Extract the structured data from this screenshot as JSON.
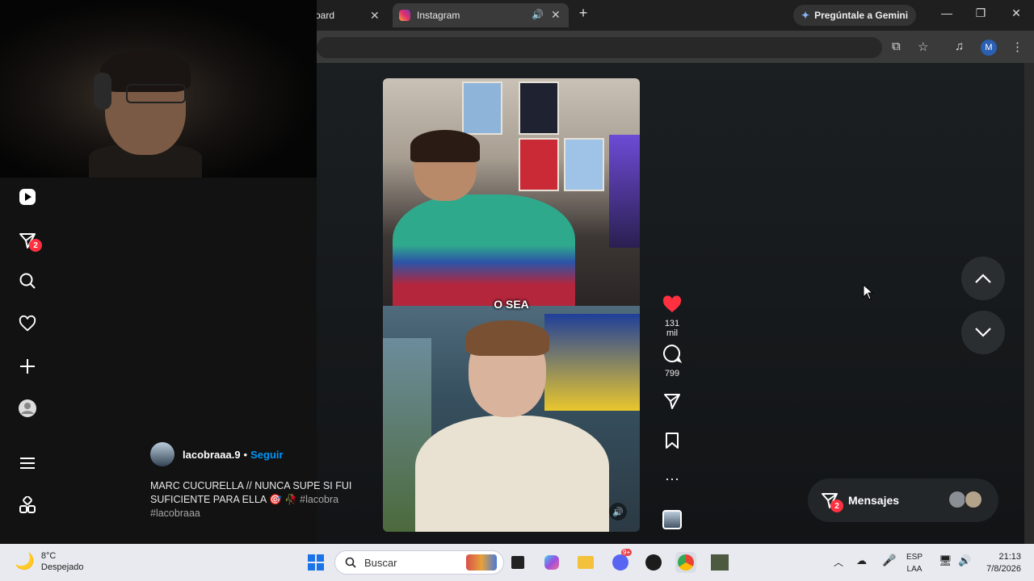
{
  "browser": {
    "tab_inactive_label": "oard",
    "tab_active_label": "Instagram",
    "gemini_label": "Pregúntale a Gemini",
    "profile_initial": "M"
  },
  "reel": {
    "overlay_caption": "O SEA",
    "likes": "131 mil",
    "comments": "799"
  },
  "post": {
    "username": "lacobraaa.9",
    "separator": "•",
    "follow_label": "Seguir",
    "description": "MARC CUCURELLA // NUNCA SUPE SI FUI SUFICIENTE PARA ELLA",
    "emoji": "🎯 🥀",
    "hashtag1": "#lacobra",
    "hashtag2": "#lacobraaa"
  },
  "sidebar": {
    "notifications_badge": "2"
  },
  "messages": {
    "label": "Mensajes",
    "badge": "2"
  },
  "taskbar": {
    "temperature": "8°C",
    "weather_condition": "Despejado",
    "search_placeholder": "Buscar",
    "discord_badge": "9+",
    "lang_top": "ESP",
    "lang_bottom": "LAA",
    "time": "21:13",
    "date": "7/8/2026"
  },
  "colors": {
    "like_red": "#ff3040",
    "follow_blue": "#0095f6",
    "page_bg": "#121212"
  },
  "icons": [
    "reels-icon",
    "direct-icon",
    "search-icon",
    "heart-icon",
    "create-icon",
    "profile-icon",
    "menu-icon",
    "more-apps-icon"
  ]
}
